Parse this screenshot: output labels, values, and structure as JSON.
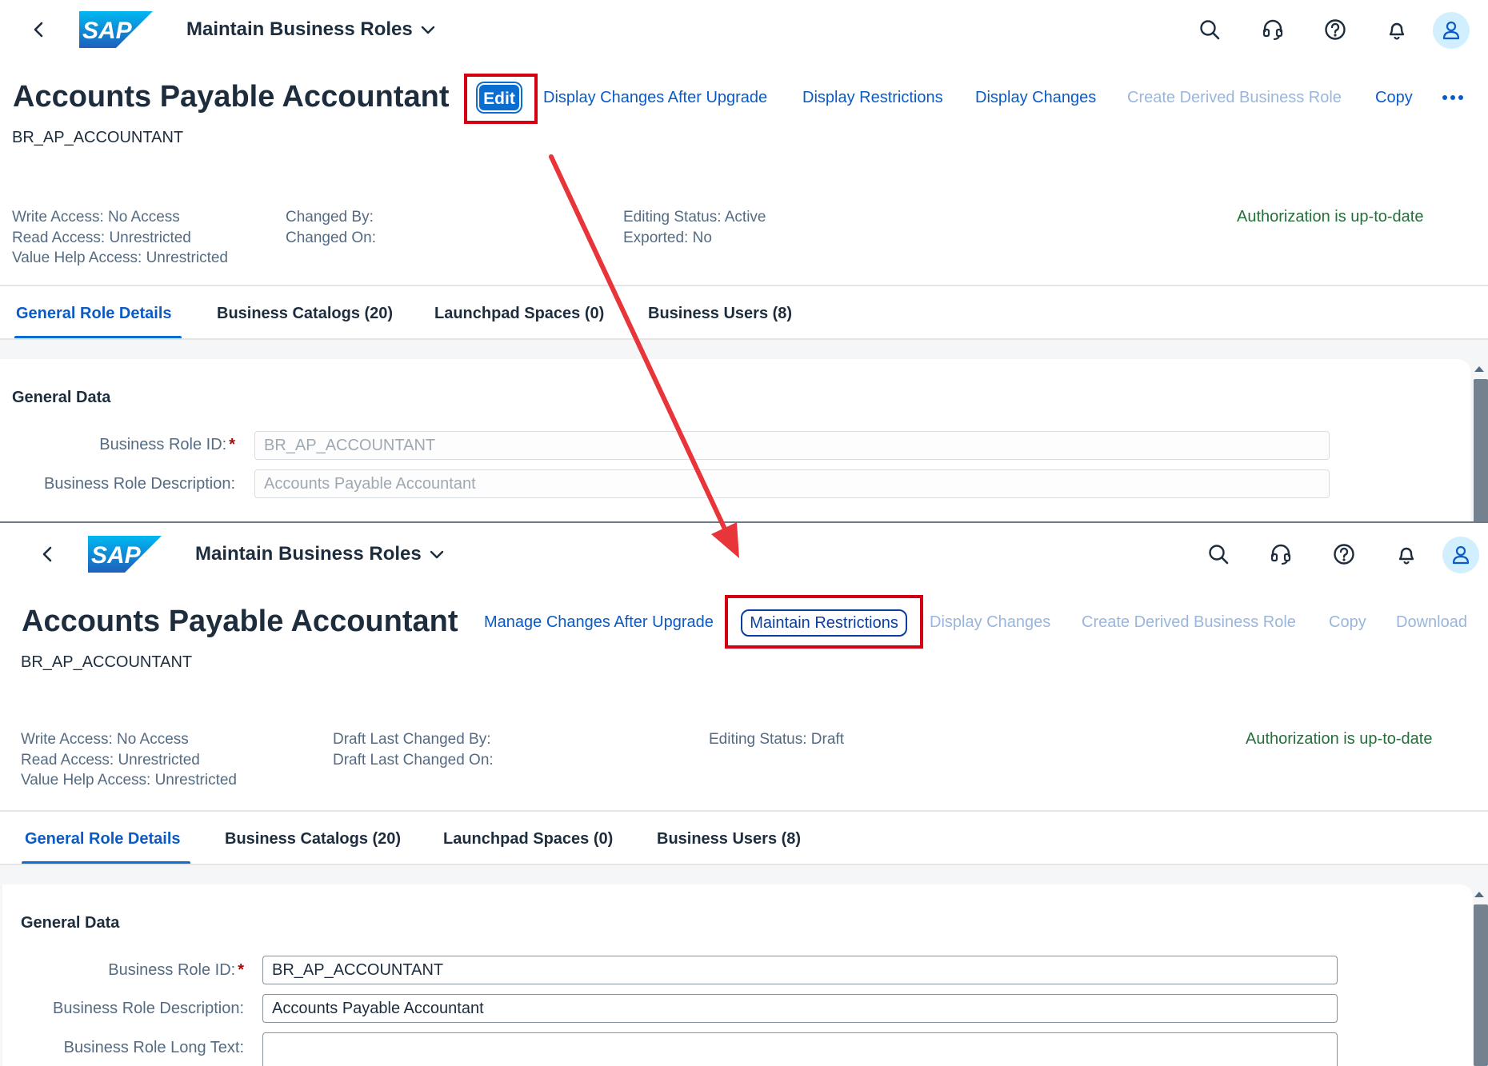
{
  "shell": {
    "app_title": "Maintain Business Roles",
    "logo_text": "SAP"
  },
  "top": {
    "title": "Accounts Payable Accountant",
    "subtitle": "BR_AP_ACCOUNTANT",
    "actions": {
      "edit": "Edit",
      "display_changes_after_upgrade": "Display Changes After Upgrade",
      "display_restrictions": "Display Restrictions",
      "display_changes": "Display Changes",
      "create_derived": "Create Derived Business Role",
      "copy": "Copy"
    },
    "meta": {
      "write_access": "Write Access: No Access",
      "read_access": "Read Access: Unrestricted",
      "value_help_access": "Value Help Access: Unrestricted",
      "changed_by": "Changed By:",
      "changed_on": "Changed On:",
      "editing_status": "Editing Status: Active",
      "exported": "Exported: No",
      "auth_status": "Authorization is up-to-date"
    },
    "tabs": [
      "General Role Details",
      "Business Catalogs (20)",
      "Launchpad Spaces (0)",
      "Business Users (8)"
    ],
    "section_title": "General Data",
    "fields": {
      "role_id_label": "Business Role ID:",
      "role_id_value": "BR_AP_ACCOUNTANT",
      "role_desc_label": "Business Role Description:",
      "role_desc_value": "Accounts Payable Accountant"
    }
  },
  "bottom": {
    "title": "Accounts Payable Accountant",
    "subtitle": "BR_AP_ACCOUNTANT",
    "actions": {
      "manage_changes_after_upgrade": "Manage Changes After Upgrade",
      "maintain_restrictions": "Maintain Restrictions",
      "display_changes": "Display Changes",
      "create_derived": "Create Derived Business Role",
      "copy": "Copy",
      "download": "Download"
    },
    "meta": {
      "write_access": "Write Access: No Access",
      "read_access": "Read Access: Unrestricted",
      "value_help_access": "Value Help Access: Unrestricted",
      "draft_changed_by": "Draft Last Changed By:",
      "draft_changed_on": "Draft Last Changed On:",
      "editing_status": "Editing Status: Draft",
      "auth_status": "Authorization is up-to-date"
    },
    "tabs": [
      "General Role Details",
      "Business Catalogs (20)",
      "Launchpad Spaces (0)",
      "Business Users (8)"
    ],
    "section_title": "General Data",
    "fields": {
      "role_id_label": "Business Role ID:",
      "role_id_value": "BR_AP_ACCOUNTANT",
      "role_desc_label": "Business Role Description:",
      "role_desc_value": "Accounts Payable Accountant",
      "long_text_label": "Business Role Long Text:",
      "long_text_value": ""
    }
  },
  "colors": {
    "link": "#0a5bc7",
    "link_disabled": "#9ab6dc",
    "positive": "#256f3a",
    "highlight": "#d40011",
    "arrow": "#e8353a"
  },
  "icons": [
    "back-icon",
    "sap-logo",
    "chevron-down-icon",
    "search-icon",
    "headset-icon",
    "help-icon",
    "bell-icon",
    "user-icon",
    "more-icon"
  ]
}
